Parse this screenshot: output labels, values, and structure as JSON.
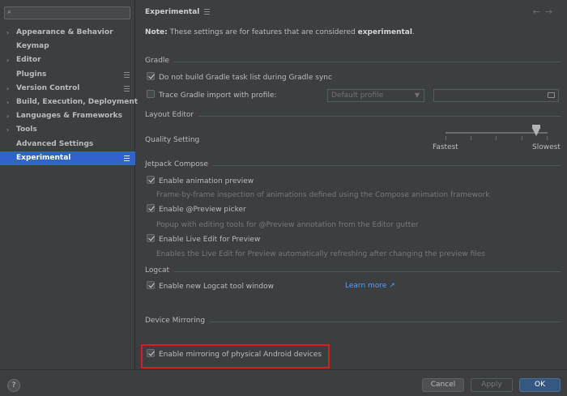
{
  "sidebar": {
    "search_placeholder": "",
    "items": [
      {
        "label": "Appearance & Behavior",
        "chevron": "›",
        "proj": false
      },
      {
        "label": "Keymap",
        "chevron": "",
        "proj": false
      },
      {
        "label": "Editor",
        "chevron": "›",
        "proj": false
      },
      {
        "label": "Plugins",
        "chevron": "",
        "proj": true
      },
      {
        "label": "Version Control",
        "chevron": "›",
        "proj": true
      },
      {
        "label": "Build, Execution, Deployment",
        "chevron": "›",
        "proj": false
      },
      {
        "label": "Languages & Frameworks",
        "chevron": "›",
        "proj": false
      },
      {
        "label": "Tools",
        "chevron": "›",
        "proj": false
      },
      {
        "label": "Advanced Settings",
        "chevron": "",
        "proj": false
      },
      {
        "label": "Experimental",
        "chevron": "",
        "proj": true,
        "selected": true
      }
    ]
  },
  "header": {
    "title": "Experimental",
    "back_arrow": "←",
    "forward_arrow": "→"
  },
  "note": {
    "prefix": "Note:",
    "text": " These settings are for features that are considered ",
    "emph": "experimental",
    "suffix": "."
  },
  "gradle": {
    "section": "Gradle",
    "no_task_list_label": "Do not build Gradle task list during Gradle sync",
    "no_task_list_checked": true,
    "trace_label": "Trace Gradle import with profile:",
    "trace_checked": false,
    "profile_value": "Default profile",
    "path_value": ""
  },
  "layout_editor": {
    "section": "Layout Editor",
    "quality_label": "Quality Setting",
    "slider_min_label": "Fastest",
    "slider_max_label": "Slowest",
    "slider_value": 0.9
  },
  "compose": {
    "section": "Jetpack Compose",
    "items": [
      {
        "label": "Enable animation preview",
        "checked": true,
        "hint": "Frame-by-frame inspection of animations defined using the Compose animation framework"
      },
      {
        "label": "Enable @Preview picker",
        "checked": true,
        "hint": "Popup with editing tools for @Preview annotation from the Editor gutter"
      },
      {
        "label": "Enable Live Edit for Preview",
        "checked": true,
        "hint": "Enables the Live Edit for Preview automatically refreshing after changing the preview files"
      }
    ]
  },
  "logcat": {
    "section": "Logcat",
    "label": "Enable new Logcat tool window",
    "checked": true,
    "learn_more": "Learn more ↗"
  },
  "mirroring": {
    "section": "Device Mirroring",
    "label": "Enable mirroring of physical Android devices",
    "checked": true
  },
  "footer": {
    "help": "?",
    "cancel": "Cancel",
    "apply": "Apply",
    "ok": "OK"
  },
  "colors": {
    "selection": "#2f65ca",
    "highlight_box": "#d6201f",
    "link": "#589df6",
    "primary_button": "#365880"
  }
}
